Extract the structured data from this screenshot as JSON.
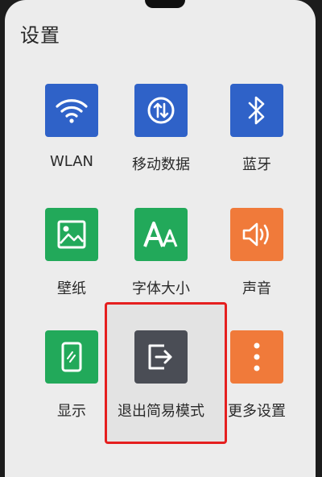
{
  "header": {
    "title": "设置"
  },
  "tiles": [
    {
      "label": "WLAN",
      "icon": "wifi-icon",
      "color": "#2f62c8"
    },
    {
      "label": "移动数据",
      "icon": "mobile-data-icon",
      "color": "#2f62c8"
    },
    {
      "label": "蓝牙",
      "icon": "bluetooth-icon",
      "color": "#2f62c8"
    },
    {
      "label": "壁纸",
      "icon": "wallpaper-icon",
      "color": "#22a95a"
    },
    {
      "label": "字体大小",
      "icon": "font-size-icon",
      "color": "#22a95a"
    },
    {
      "label": "声音",
      "icon": "sound-icon",
      "color": "#f07a3a"
    },
    {
      "label": "显示",
      "icon": "display-icon",
      "color": "#22a95a"
    },
    {
      "label": "退出简易模式",
      "icon": "exit-icon",
      "color": "#4a4d55"
    },
    {
      "label": "更多设置",
      "icon": "more-icon",
      "color": "#f07a3a"
    }
  ],
  "highlight_color": "#e51f1f"
}
